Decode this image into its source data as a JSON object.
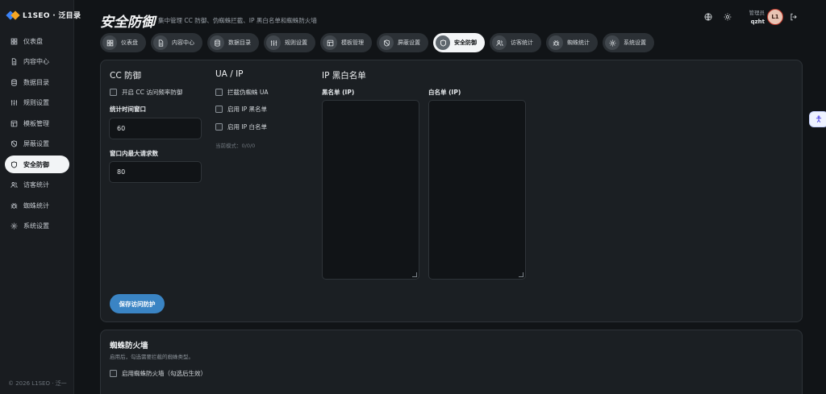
{
  "brand": {
    "name": "L1SEO · 泛目录"
  },
  "sidebar": {
    "items": [
      {
        "label": "仪表盘",
        "icon": "dashboard-icon"
      },
      {
        "label": "内容中心",
        "icon": "document-icon"
      },
      {
        "label": "数据目录",
        "icon": "database-icon"
      },
      {
        "label": "规则设置",
        "icon": "rules-icon"
      },
      {
        "label": "模板管理",
        "icon": "template-icon"
      },
      {
        "label": "屏蔽设置",
        "icon": "block-icon"
      },
      {
        "label": "安全防御",
        "icon": "shield-icon",
        "active": true
      },
      {
        "label": "访客统计",
        "icon": "users-icon"
      },
      {
        "label": "蜘蛛统计",
        "icon": "spider-icon"
      },
      {
        "label": "系统设置",
        "icon": "gear-icon"
      }
    ],
    "footer": "© 2026 L1SEO · 泛一"
  },
  "header": {
    "title": "安全防御",
    "subtitle": "集中管理 CC 防御、伪蜘蛛拦截、IP 黑白名单和蜘蛛防火墙",
    "user_role": "管理员",
    "user_name": "qzht",
    "avatar_initials": "L1"
  },
  "tabs": [
    {
      "label": "仪表盘",
      "icon": "dashboard-icon"
    },
    {
      "label": "内容中心",
      "icon": "document-icon"
    },
    {
      "label": "数据目录",
      "icon": "database-icon"
    },
    {
      "label": "规则设置",
      "icon": "rules-icon"
    },
    {
      "label": "模板管理",
      "icon": "template-icon"
    },
    {
      "label": "屏蔽设置",
      "icon": "block-icon"
    },
    {
      "label": "安全防御",
      "icon": "shield-icon",
      "active": true
    },
    {
      "label": "访客统计",
      "icon": "users-icon"
    },
    {
      "label": "蜘蛛统计",
      "icon": "spider-icon"
    },
    {
      "label": "系统设置",
      "icon": "gear-icon"
    }
  ],
  "cc": {
    "title": "CC 防御",
    "enable_label": "开启 CC 访问频率防御",
    "window_label": "统计时间窗口",
    "window_value": "60",
    "max_label": "窗口内最大请求数",
    "max_value": "80"
  },
  "uaip": {
    "title": "UA / IP",
    "fake_spider_label": "拦截伪蜘蛛 UA",
    "blacklist_label": "启用 IP 黑名单",
    "whitelist_label": "启用 IP 白名单",
    "mode_text": "当前模式：0/0/0"
  },
  "iplists": {
    "title": "IP 黑白名单",
    "black_label": "黑名单 (IP)",
    "white_label": "白名单 (IP)"
  },
  "save_label": "保存访问防护",
  "firewall": {
    "title": "蜘蛛防火墙",
    "desc": "启用后，勾选需要拦截的蜘蛛类型。",
    "enable_label": "启用蜘蛛防火墙（勾选后生效）"
  }
}
